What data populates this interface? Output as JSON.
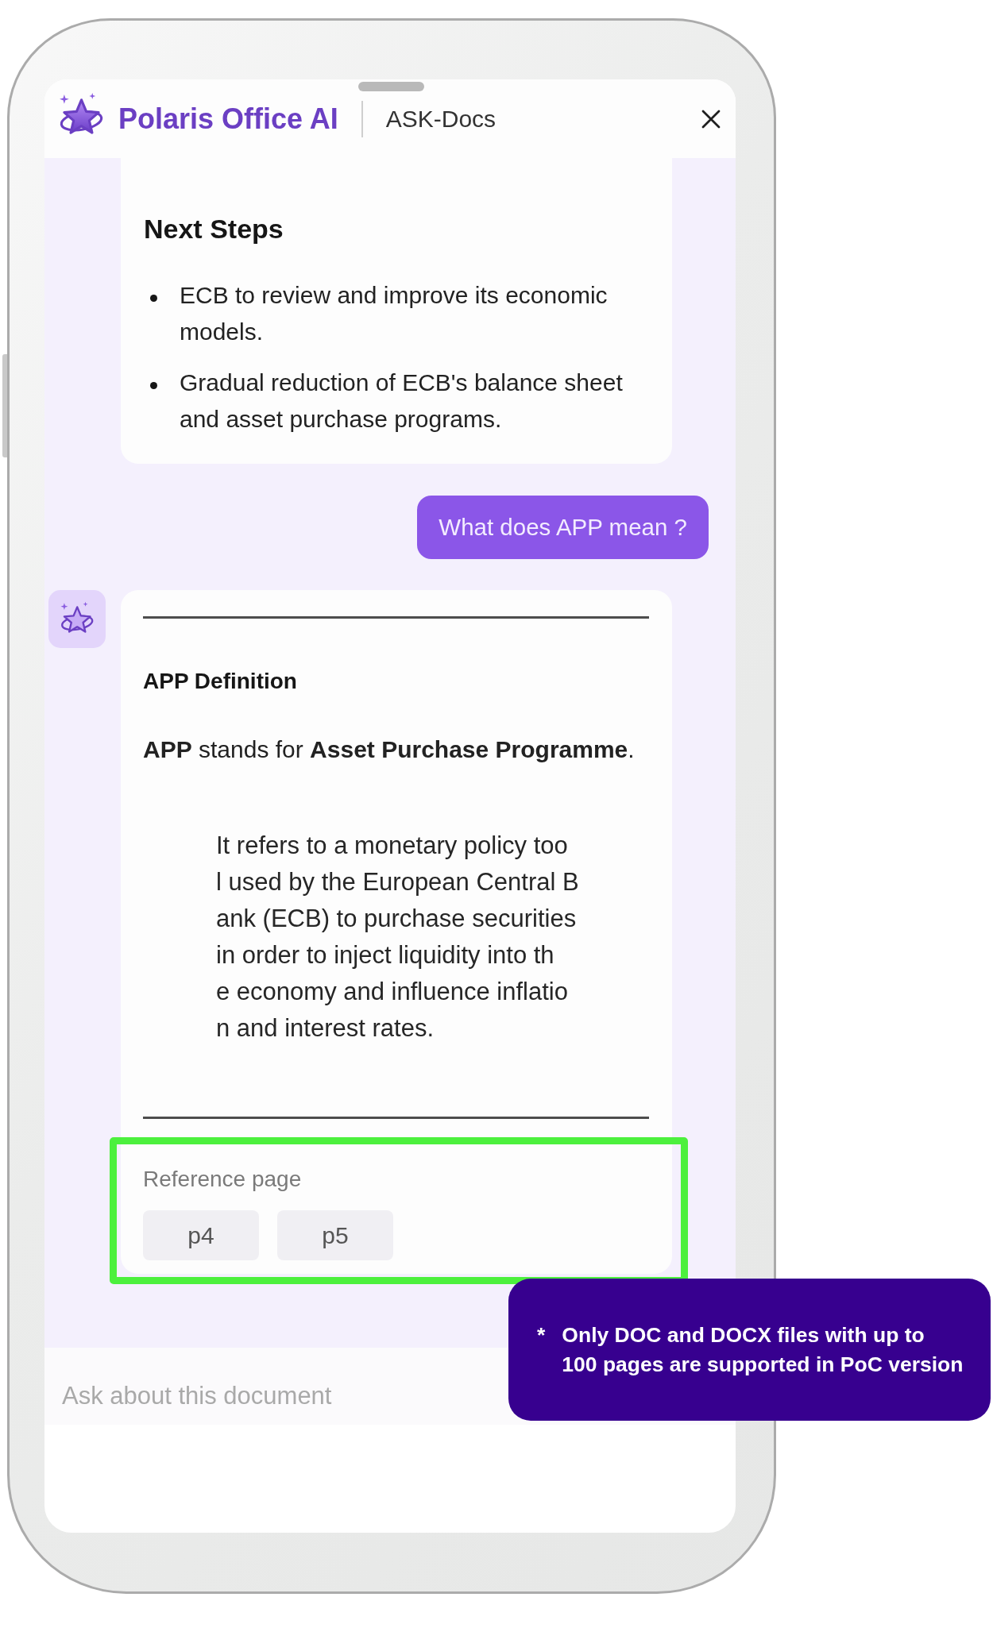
{
  "header": {
    "brand": "Polaris Office AI",
    "title": "ASK-Docs"
  },
  "messages": [
    {
      "kind": "answer",
      "avatar": false,
      "heading": "Next Steps",
      "bullets": [
        "ECB to review and improve its economic models.",
        "Gradual reduction of ECB's balance sheet and asset purchase programs."
      ]
    },
    {
      "kind": "question",
      "text": "What does APP mean ?"
    },
    {
      "kind": "answer",
      "avatar": true,
      "heading": "APP Definition",
      "text": "**APP** stands for **Asset Purchase Programme**.",
      "quote": "It refers to a monetary policy too\nl used by the European Central B\nank (ECB) to purchase securities\nin order to inject liquidity into th\ne economy and influence inflatio\nn and interest rates.",
      "reference": {
        "label": "Reference page",
        "pages": [
          "p4",
          "p5"
        ],
        "highlighted": true
      }
    }
  ],
  "input": {
    "placeholder": "Ask about this document"
  },
  "note": {
    "marker": "*",
    "text": "Only DOC and DOCX files with up to\n100 pages are supported in PoC version"
  }
}
